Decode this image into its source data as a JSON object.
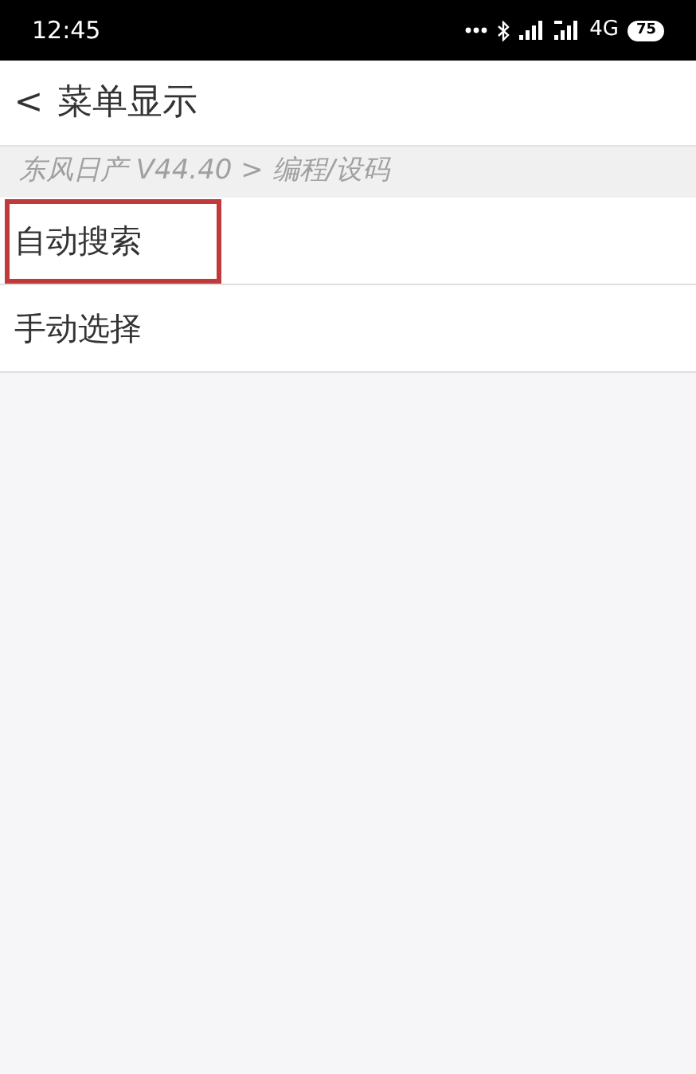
{
  "status_bar": {
    "time": "12:45",
    "network": "4G",
    "battery": "75"
  },
  "header": {
    "back": "<",
    "title": "菜单显示"
  },
  "breadcrumb": "东风日产 V44.40 > 编程/设码",
  "menu": [
    {
      "label": "自动搜索",
      "highlighted": true
    },
    {
      "label": "手动选择",
      "highlighted": false
    }
  ]
}
